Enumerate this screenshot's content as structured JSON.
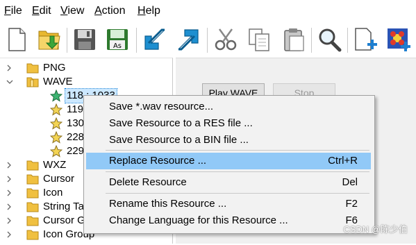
{
  "menu": {
    "file": {
      "u": "F",
      "rest": "ile"
    },
    "edit": {
      "u": "E",
      "rest": "dit"
    },
    "view": {
      "u": "V",
      "rest": "iew"
    },
    "action": {
      "u": "A",
      "rest": "ction"
    },
    "help": {
      "u": "H",
      "rest": "elp"
    }
  },
  "toolbar": [
    "new-file-icon",
    "open-folder-icon",
    "save-icon",
    "save-as-icon",
    "import-arrow-icon",
    "export-arrow-icon",
    "cut-icon",
    "copy-icon",
    "paste-icon",
    "search-icon",
    "new-resource-icon",
    "resource-image-icon"
  ],
  "tree": {
    "png": "PNG",
    "wave": "WAVE",
    "wave_children": [
      "118 : 1033",
      "119",
      "130",
      "228",
      "229"
    ],
    "wxz": "WXZ",
    "cursor": "Cursor",
    "icon": "Icon",
    "string_table": "String Ta",
    "cursor_group": "Cursor G",
    "icon_group": "Icon Group"
  },
  "panel": {
    "play_label": "Play WAVE",
    "stop_label": "Stop"
  },
  "context_menu": {
    "save_wav": "Save *.wav resource...",
    "save_res": "Save Resource to a RES file ...",
    "save_bin": "Save Resource to a BIN file ...",
    "replace": "Replace Resource ...",
    "replace_key": "Ctrl+R",
    "delete": "Delete Resource",
    "delete_key": "Del",
    "rename": "Rename this Resource ...",
    "rename_key": "F2",
    "change_lang": "Change Language for this Resource ...",
    "change_lang_key": "F6"
  },
  "colors": {
    "highlight": "#91c9f7",
    "selection": "#cce8ff",
    "menu_bg": "#f2f2f2",
    "panel_bg": "#f0f0f0",
    "folder": "#f0c040",
    "star": "#f3d454"
  },
  "watermark": "CSDN @陈少伯"
}
